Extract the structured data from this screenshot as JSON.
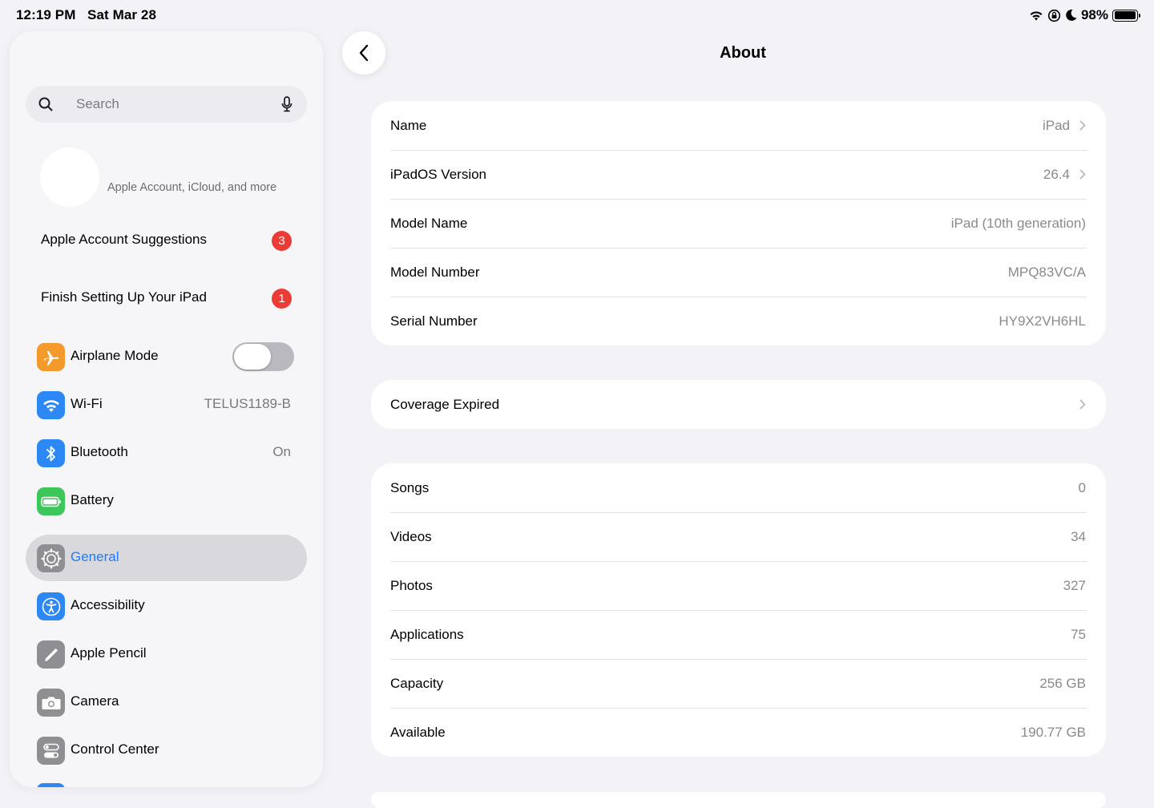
{
  "status_bar": {
    "time": "12:19 PM",
    "date": "Sat Mar 28",
    "battery_percent": "98%",
    "battery_level": 0.98
  },
  "sidebar": {
    "search_placeholder": "Search",
    "account_subtitle": "Apple Account, iCloud, and more",
    "suggestions": [
      {
        "label": "Apple Account Suggestions",
        "badge": "3"
      },
      {
        "label": "Finish Setting Up Your iPad",
        "badge": "1"
      }
    ],
    "items": [
      {
        "label": "Airplane Mode",
        "icon": "airplane-icon",
        "color": "#f39a2b",
        "toggle": false
      },
      {
        "label": "Wi-Fi",
        "icon": "wifi-icon",
        "color": "#2c88f5",
        "value": "TELUS1189-B"
      },
      {
        "label": "Bluetooth",
        "icon": "bluetooth-icon",
        "color": "#2c88f5",
        "value": "On"
      },
      {
        "label": "Battery",
        "icon": "battery-icon",
        "color": "#3dc659"
      },
      {
        "label": "General",
        "icon": "gear-icon",
        "color": "#8e8e93",
        "selected": true
      },
      {
        "label": "Accessibility",
        "icon": "accessibility-icon",
        "color": "#2c88f5"
      },
      {
        "label": "Apple Pencil",
        "icon": "pencil-icon",
        "color": "#8e8e93"
      },
      {
        "label": "Camera",
        "icon": "camera-icon",
        "color": "#8e8e93"
      },
      {
        "label": "Control Center",
        "icon": "control-center-icon",
        "color": "#8e8e93"
      }
    ],
    "selected_color": "#1f7cf6"
  },
  "header": {
    "title": "About"
  },
  "groups": {
    "device": [
      {
        "label": "Name",
        "value": "iPad",
        "chevron": true
      },
      {
        "label": "iPadOS Version",
        "value": "26.4",
        "chevron": true
      },
      {
        "label": "Model Name",
        "value": "iPad (10th generation)"
      },
      {
        "label": "Model Number",
        "value": "MPQ83VC/A"
      },
      {
        "label": "Serial Number",
        "value": "HY9X2VH6HL"
      }
    ],
    "coverage": [
      {
        "label": "Coverage Expired",
        "chevron": true
      }
    ],
    "storage": [
      {
        "label": "Songs",
        "value": "0"
      },
      {
        "label": "Videos",
        "value": "34"
      },
      {
        "label": "Photos",
        "value": "327"
      },
      {
        "label": "Applications",
        "value": "75"
      },
      {
        "label": "Capacity",
        "value": "256 GB"
      },
      {
        "label": "Available",
        "value": "190.77 GB"
      }
    ]
  }
}
